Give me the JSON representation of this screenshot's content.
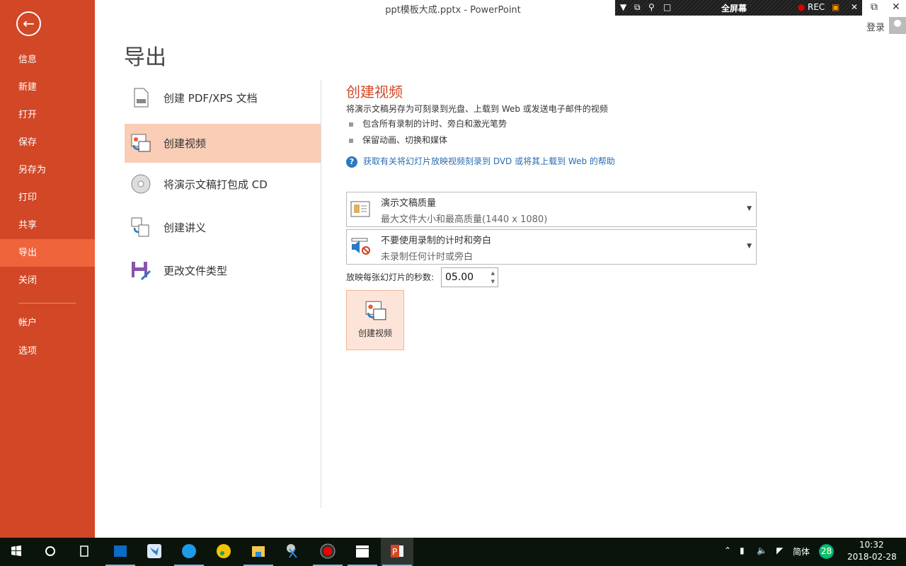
{
  "window": {
    "title": "ppt模板大成.pptx - PowerPoint",
    "login": "登录",
    "restore_icon": "restore-icon",
    "close_icon": "close-icon"
  },
  "recorder": {
    "mode": "全屏幕",
    "rec": "REC"
  },
  "sidebar": {
    "items": [
      {
        "label": "信息"
      },
      {
        "label": "新建"
      },
      {
        "label": "打开"
      },
      {
        "label": "保存"
      },
      {
        "label": "另存为"
      },
      {
        "label": "打印"
      },
      {
        "label": "共享"
      },
      {
        "label": "导出"
      },
      {
        "label": "关闭"
      },
      {
        "label": "帐户"
      },
      {
        "label": "选项"
      }
    ],
    "active": "导出"
  },
  "page": {
    "title": "导出"
  },
  "export_options": [
    {
      "label": "创建 PDF/XPS 文档"
    },
    {
      "label": "创建视频"
    },
    {
      "label": "将演示文稿打包成 CD"
    },
    {
      "label": "创建讲义"
    },
    {
      "label": "更改文件类型"
    }
  ],
  "detail": {
    "heading": "创建视频",
    "description": "将演示文稿另存为可刻录到光盘、上载到 Web 或发送电子邮件的视频",
    "bullets": [
      "包含所有录制的计时、旁白和激光笔势",
      "保留动画、切换和媒体"
    ],
    "help_link": "获取有关将幻灯片放映视频刻录到 DVD 或将其上载到 Web 的帮助",
    "quality": {
      "title": "演示文稿质量",
      "subtitle": "最大文件大小和最高质量(1440 x 1080)"
    },
    "timing": {
      "title": "不要使用录制的计时和旁白",
      "subtitle": "未录制任何计时或旁白"
    },
    "seconds_label": "放映每张幻灯片的秒数:",
    "seconds_value": "05.00",
    "create_button": "创建视频"
  },
  "taskbar": {
    "tray": {
      "ime": "简体",
      "badge": "28",
      "time": "10:32",
      "date": "2018-02-28"
    }
  },
  "colors": {
    "accent": "#D24726",
    "active": "#F0643C",
    "selected": "#F9CDB6"
  }
}
